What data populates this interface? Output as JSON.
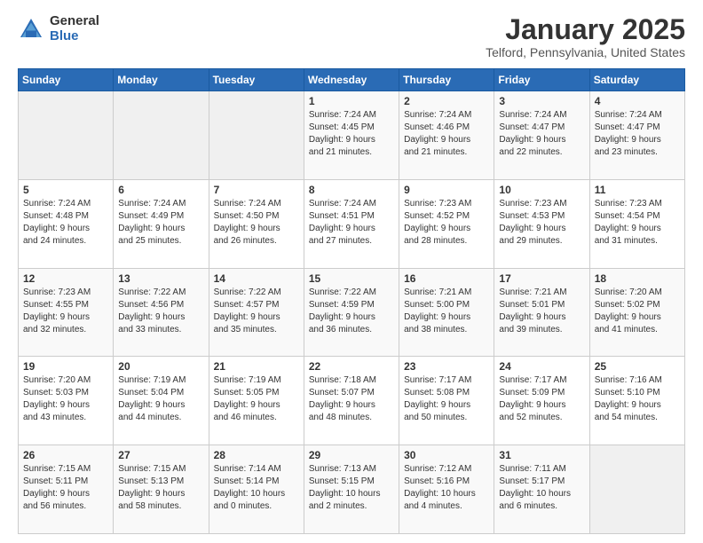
{
  "header": {
    "logo_general": "General",
    "logo_blue": "Blue",
    "month": "January 2025",
    "location": "Telford, Pennsylvania, United States"
  },
  "weekdays": [
    "Sunday",
    "Monday",
    "Tuesday",
    "Wednesday",
    "Thursday",
    "Friday",
    "Saturday"
  ],
  "weeks": [
    [
      {
        "day": "",
        "info": ""
      },
      {
        "day": "",
        "info": ""
      },
      {
        "day": "",
        "info": ""
      },
      {
        "day": "1",
        "info": "Sunrise: 7:24 AM\nSunset: 4:45 PM\nDaylight: 9 hours\nand 21 minutes."
      },
      {
        "day": "2",
        "info": "Sunrise: 7:24 AM\nSunset: 4:46 PM\nDaylight: 9 hours\nand 21 minutes."
      },
      {
        "day": "3",
        "info": "Sunrise: 7:24 AM\nSunset: 4:47 PM\nDaylight: 9 hours\nand 22 minutes."
      },
      {
        "day": "4",
        "info": "Sunrise: 7:24 AM\nSunset: 4:47 PM\nDaylight: 9 hours\nand 23 minutes."
      }
    ],
    [
      {
        "day": "5",
        "info": "Sunrise: 7:24 AM\nSunset: 4:48 PM\nDaylight: 9 hours\nand 24 minutes."
      },
      {
        "day": "6",
        "info": "Sunrise: 7:24 AM\nSunset: 4:49 PM\nDaylight: 9 hours\nand 25 minutes."
      },
      {
        "day": "7",
        "info": "Sunrise: 7:24 AM\nSunset: 4:50 PM\nDaylight: 9 hours\nand 26 minutes."
      },
      {
        "day": "8",
        "info": "Sunrise: 7:24 AM\nSunset: 4:51 PM\nDaylight: 9 hours\nand 27 minutes."
      },
      {
        "day": "9",
        "info": "Sunrise: 7:23 AM\nSunset: 4:52 PM\nDaylight: 9 hours\nand 28 minutes."
      },
      {
        "day": "10",
        "info": "Sunrise: 7:23 AM\nSunset: 4:53 PM\nDaylight: 9 hours\nand 29 minutes."
      },
      {
        "day": "11",
        "info": "Sunrise: 7:23 AM\nSunset: 4:54 PM\nDaylight: 9 hours\nand 31 minutes."
      }
    ],
    [
      {
        "day": "12",
        "info": "Sunrise: 7:23 AM\nSunset: 4:55 PM\nDaylight: 9 hours\nand 32 minutes."
      },
      {
        "day": "13",
        "info": "Sunrise: 7:22 AM\nSunset: 4:56 PM\nDaylight: 9 hours\nand 33 minutes."
      },
      {
        "day": "14",
        "info": "Sunrise: 7:22 AM\nSunset: 4:57 PM\nDaylight: 9 hours\nand 35 minutes."
      },
      {
        "day": "15",
        "info": "Sunrise: 7:22 AM\nSunset: 4:59 PM\nDaylight: 9 hours\nand 36 minutes."
      },
      {
        "day": "16",
        "info": "Sunrise: 7:21 AM\nSunset: 5:00 PM\nDaylight: 9 hours\nand 38 minutes."
      },
      {
        "day": "17",
        "info": "Sunrise: 7:21 AM\nSunset: 5:01 PM\nDaylight: 9 hours\nand 39 minutes."
      },
      {
        "day": "18",
        "info": "Sunrise: 7:20 AM\nSunset: 5:02 PM\nDaylight: 9 hours\nand 41 minutes."
      }
    ],
    [
      {
        "day": "19",
        "info": "Sunrise: 7:20 AM\nSunset: 5:03 PM\nDaylight: 9 hours\nand 43 minutes."
      },
      {
        "day": "20",
        "info": "Sunrise: 7:19 AM\nSunset: 5:04 PM\nDaylight: 9 hours\nand 44 minutes."
      },
      {
        "day": "21",
        "info": "Sunrise: 7:19 AM\nSunset: 5:05 PM\nDaylight: 9 hours\nand 46 minutes."
      },
      {
        "day": "22",
        "info": "Sunrise: 7:18 AM\nSunset: 5:07 PM\nDaylight: 9 hours\nand 48 minutes."
      },
      {
        "day": "23",
        "info": "Sunrise: 7:17 AM\nSunset: 5:08 PM\nDaylight: 9 hours\nand 50 minutes."
      },
      {
        "day": "24",
        "info": "Sunrise: 7:17 AM\nSunset: 5:09 PM\nDaylight: 9 hours\nand 52 minutes."
      },
      {
        "day": "25",
        "info": "Sunrise: 7:16 AM\nSunset: 5:10 PM\nDaylight: 9 hours\nand 54 minutes."
      }
    ],
    [
      {
        "day": "26",
        "info": "Sunrise: 7:15 AM\nSunset: 5:11 PM\nDaylight: 9 hours\nand 56 minutes."
      },
      {
        "day": "27",
        "info": "Sunrise: 7:15 AM\nSunset: 5:13 PM\nDaylight: 9 hours\nand 58 minutes."
      },
      {
        "day": "28",
        "info": "Sunrise: 7:14 AM\nSunset: 5:14 PM\nDaylight: 10 hours\nand 0 minutes."
      },
      {
        "day": "29",
        "info": "Sunrise: 7:13 AM\nSunset: 5:15 PM\nDaylight: 10 hours\nand 2 minutes."
      },
      {
        "day": "30",
        "info": "Sunrise: 7:12 AM\nSunset: 5:16 PM\nDaylight: 10 hours\nand 4 minutes."
      },
      {
        "day": "31",
        "info": "Sunrise: 7:11 AM\nSunset: 5:17 PM\nDaylight: 10 hours\nand 6 minutes."
      },
      {
        "day": "",
        "info": ""
      }
    ]
  ]
}
